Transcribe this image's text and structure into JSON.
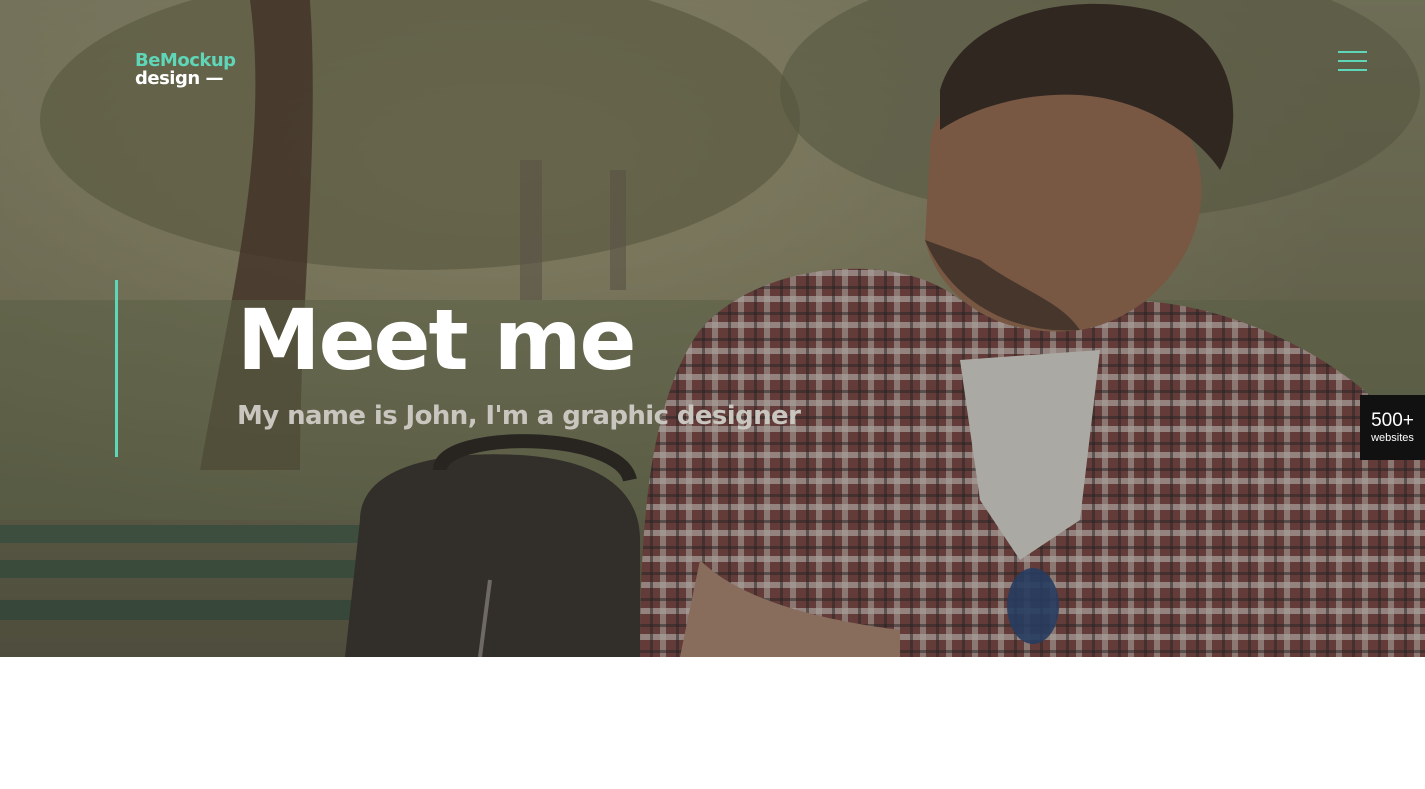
{
  "logo": {
    "line1": "BeMockup",
    "line2": "design —"
  },
  "hero": {
    "title": "Meet me",
    "subtitle": "My name is John, I'm a graphic designer"
  },
  "badge": {
    "count": "500+",
    "label": "websites"
  },
  "colors": {
    "accent": "#5fd6b8",
    "badge_bg": "#111111",
    "subtitle": "#c9c6c0"
  },
  "icons": {
    "menu": "hamburger-menu-icon"
  }
}
